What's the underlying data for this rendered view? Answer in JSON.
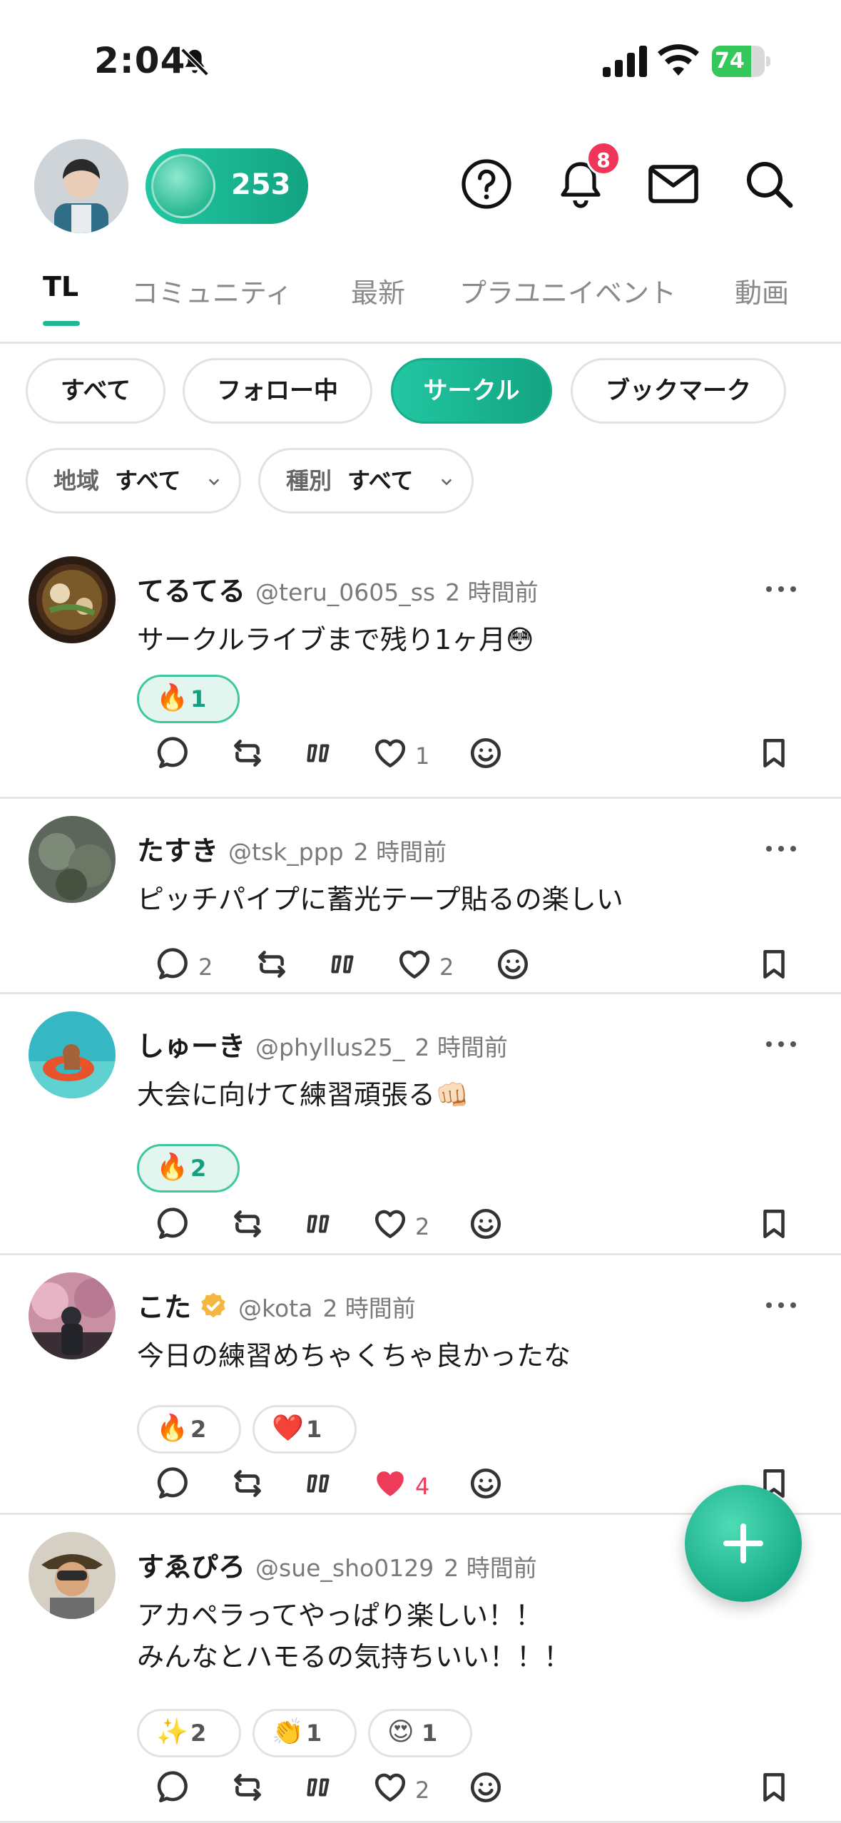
{
  "status": {
    "time": "2:04",
    "battery": "74"
  },
  "header": {
    "points": "253",
    "notifications_count": "8"
  },
  "tabs": [
    "TL",
    "コミュニティ",
    "最新",
    "プラユニイベント",
    "動画"
  ],
  "filters": [
    "すべて",
    "フォロー中",
    "サークル",
    "ブックマーク"
  ],
  "dropdowns": [
    {
      "label": "地域",
      "value": "すべて"
    },
    {
      "label": "種別",
      "value": "すべて"
    }
  ],
  "posts": [
    {
      "name": "てるてる",
      "handle": "@teru_0605_ss",
      "time": "2 時間前",
      "lines": [
        "サークルライブまで残り1ヶ月😳"
      ],
      "reactions": [
        {
          "emoji": "🔥",
          "count": "1",
          "mine": true
        }
      ],
      "replies": "",
      "likes": "1",
      "liked": false
    },
    {
      "name": "たすき",
      "handle": "@tsk_ppp",
      "time": "2 時間前",
      "lines": [
        "ピッチパイプに蓄光テープ貼るの楽しい"
      ],
      "reactions": [],
      "replies": "2",
      "likes": "2",
      "liked": false
    },
    {
      "name": "しゅーき",
      "handle": "@phyllus25_",
      "time": "2 時間前",
      "lines": [
        "大会に向けて練習頑張る👊🏻"
      ],
      "reactions": [
        {
          "emoji": "🔥",
          "count": "2",
          "mine": true
        }
      ],
      "replies": "",
      "likes": "2",
      "liked": false
    },
    {
      "name": "こた",
      "handle": "@kota",
      "time": "2 時間前",
      "lines": [
        "今日の練習めちゃくちゃ良かったな"
      ],
      "reactions": [
        {
          "emoji": "🔥",
          "count": "2",
          "mine": false
        },
        {
          "emoji": "❤️",
          "count": "1",
          "mine": false
        }
      ],
      "replies": "",
      "likes": "4",
      "liked": true
    },
    {
      "name": "すゑぴろ",
      "handle": "@sue_sho0129",
      "time": "2 時間前",
      "lines": [
        "アカペラってやっぱり楽しい！！",
        "みんなとハモるの気持ちいい！！！"
      ],
      "reactions": [
        {
          "emoji": "✨",
          "count": "2",
          "mine": false
        },
        {
          "emoji": "👏",
          "count": "1",
          "mine": false
        },
        {
          "emoji": "😍",
          "count": "1",
          "mine": false
        }
      ],
      "replies": "",
      "likes": "2",
      "liked": false
    }
  ]
}
